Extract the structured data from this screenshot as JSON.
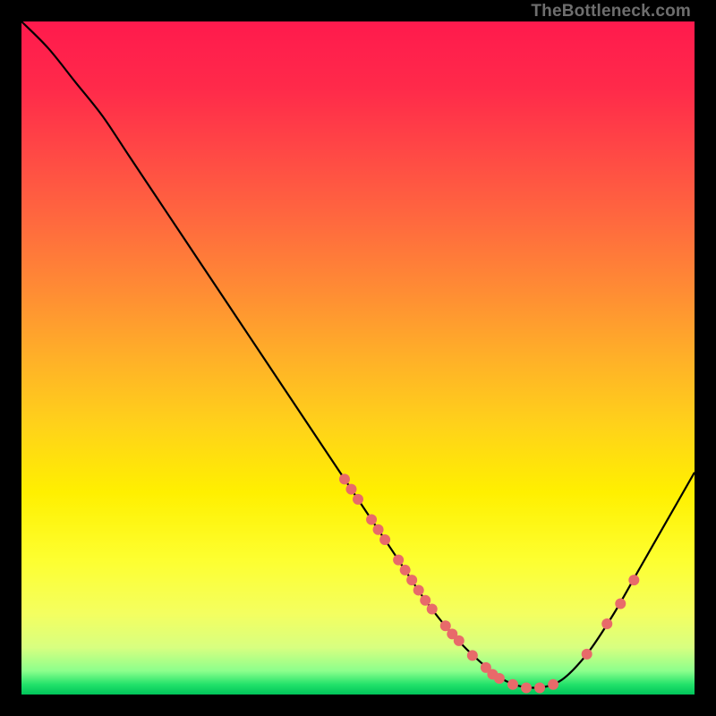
{
  "watermark": "TheBottleneck.com",
  "chart_data": {
    "type": "line",
    "title": "",
    "xlabel": "",
    "ylabel": "",
    "xlim": [
      0,
      100
    ],
    "ylim": [
      0,
      100
    ],
    "grid": false,
    "legend": false,
    "series": [
      {
        "name": "curve",
        "x": [
          0,
          4,
          8,
          12,
          16,
          20,
          24,
          28,
          32,
          36,
          40,
          44,
          48,
          52,
          56,
          60,
          64,
          68,
          72,
          76,
          80,
          84,
          88,
          92,
          96,
          100
        ],
        "y": [
          100,
          96,
          91,
          86,
          80,
          74,
          68,
          62,
          56,
          50,
          44,
          38,
          32,
          26,
          20,
          14,
          9,
          5,
          2,
          1,
          2,
          6,
          12,
          19,
          26,
          33
        ]
      }
    ],
    "marker_points": [
      {
        "x": 48,
        "y": 32
      },
      {
        "x": 49,
        "y": 30.5
      },
      {
        "x": 50,
        "y": 29
      },
      {
        "x": 52,
        "y": 26
      },
      {
        "x": 53,
        "y": 24.5
      },
      {
        "x": 54,
        "y": 23
      },
      {
        "x": 56,
        "y": 20
      },
      {
        "x": 57,
        "y": 18.5
      },
      {
        "x": 58,
        "y": 17
      },
      {
        "x": 59,
        "y": 15.5
      },
      {
        "x": 60,
        "y": 14
      },
      {
        "x": 61,
        "y": 12.7
      },
      {
        "x": 63,
        "y": 10.2
      },
      {
        "x": 64,
        "y": 9
      },
      {
        "x": 65,
        "y": 8
      },
      {
        "x": 67,
        "y": 5.8
      },
      {
        "x": 69,
        "y": 4
      },
      {
        "x": 70,
        "y": 3
      },
      {
        "x": 71,
        "y": 2.4
      },
      {
        "x": 73,
        "y": 1.5
      },
      {
        "x": 75,
        "y": 1
      },
      {
        "x": 77,
        "y": 1
      },
      {
        "x": 79,
        "y": 1.5
      },
      {
        "x": 84,
        "y": 6
      },
      {
        "x": 87,
        "y": 10.5
      },
      {
        "x": 89,
        "y": 13.5
      },
      {
        "x": 91,
        "y": 17
      }
    ],
    "gradient_stops": [
      {
        "offset": 0.0,
        "color": "#ff1a4d"
      },
      {
        "offset": 0.1,
        "color": "#ff2a4a"
      },
      {
        "offset": 0.2,
        "color": "#ff4a45"
      },
      {
        "offset": 0.3,
        "color": "#ff6a3e"
      },
      {
        "offset": 0.4,
        "color": "#ff8c34"
      },
      {
        "offset": 0.5,
        "color": "#ffb028"
      },
      {
        "offset": 0.6,
        "color": "#ffd21a"
      },
      {
        "offset": 0.7,
        "color": "#fff000"
      },
      {
        "offset": 0.8,
        "color": "#fdff30"
      },
      {
        "offset": 0.88,
        "color": "#f4ff60"
      },
      {
        "offset": 0.93,
        "color": "#d8ff80"
      },
      {
        "offset": 0.965,
        "color": "#8cff8c"
      },
      {
        "offset": 0.985,
        "color": "#22e26a"
      },
      {
        "offset": 1.0,
        "color": "#00c45a"
      }
    ],
    "marker_color": "#e86a6a",
    "curve_color": "#000000"
  }
}
